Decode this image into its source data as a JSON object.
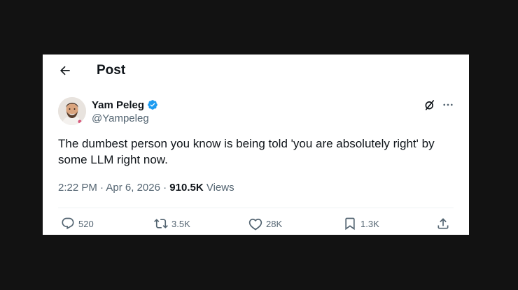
{
  "header": {
    "title": "Post"
  },
  "author": {
    "name": "Yam Peleg",
    "handle": "@Yampeleg"
  },
  "post": {
    "text": "The dumbest person you know is being told 'you are absolutely right' by some LLM right now.",
    "time": "2:22 PM",
    "separator": " · ",
    "date": "Apr 6, 2026",
    "views_count": "910.5K",
    "views_label": " Views"
  },
  "actions": {
    "replies": "520",
    "reposts": "3.5K",
    "likes": "28K",
    "bookmarks": "1.3K"
  },
  "icons": {
    "back": "arrow-left-icon",
    "verified": "verified-badge-icon",
    "grok": "grok-icon",
    "more": "more-icon",
    "reply": "reply-icon",
    "repost": "repost-icon",
    "like": "heart-icon",
    "bookmark": "bookmark-icon",
    "share": "share-icon"
  },
  "colors": {
    "background": "#121212",
    "card": "#ffffff",
    "text": "#0f1419",
    "secondary": "#536471",
    "verified": "#1d9bf0"
  }
}
